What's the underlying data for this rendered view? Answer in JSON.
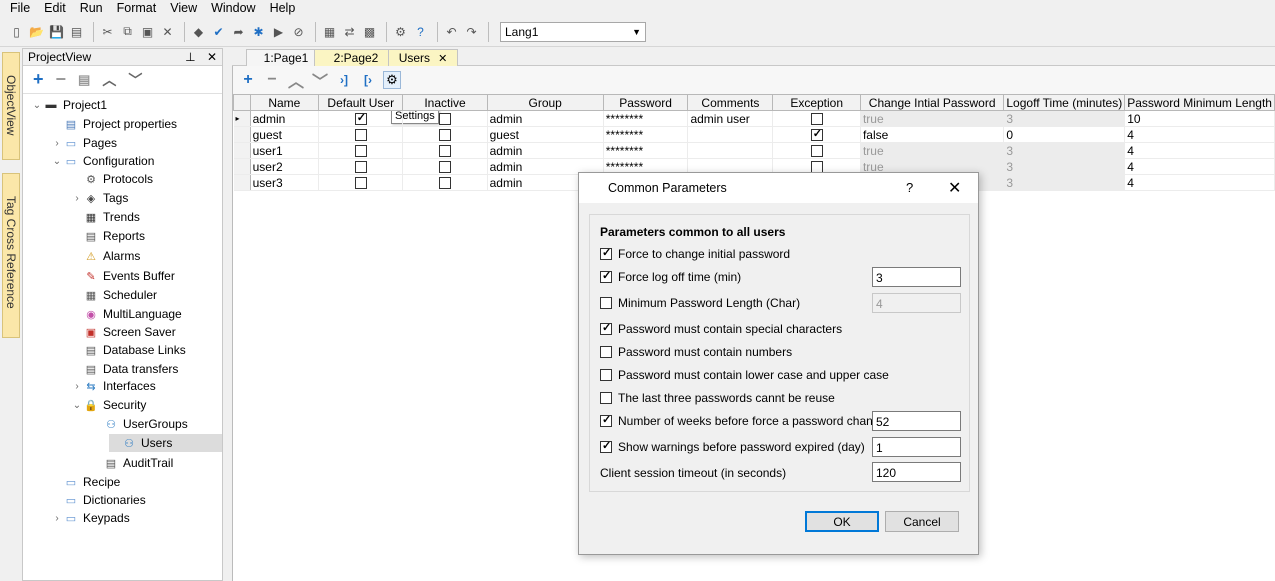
{
  "menu": [
    "File",
    "Edit",
    "Run",
    "Format",
    "View",
    "Window",
    "Help"
  ],
  "toolbar": {
    "language": "Lang1"
  },
  "side_tabs": {
    "objectview": "ObjectView",
    "tagcross": "Tag Cross Reference"
  },
  "projectview": {
    "title": "ProjectView",
    "pin": "⊥",
    "close": "✕",
    "tree": [
      {
        "label": "Project1",
        "depth": 0,
        "arrow": "⌄",
        "icon": "▬"
      },
      {
        "label": "Project properties",
        "depth": 1,
        "arrow": "",
        "icon": "▤"
      },
      {
        "label": "Pages",
        "depth": 1,
        "arrow": "›",
        "icon": "▭"
      },
      {
        "label": "Configuration",
        "depth": 1,
        "arrow": "⌄",
        "icon": "▭"
      },
      {
        "label": "Protocols",
        "depth": 2,
        "arrow": "",
        "icon": "⚙"
      },
      {
        "label": "Tags",
        "depth": 2,
        "arrow": "›",
        "icon": "◈"
      },
      {
        "label": "Trends",
        "depth": 2,
        "arrow": "",
        "icon": "▦"
      },
      {
        "label": "Reports",
        "depth": 2,
        "arrow": "",
        "icon": "▤"
      },
      {
        "label": "Alarms",
        "depth": 2,
        "arrow": "",
        "icon": "⚠"
      },
      {
        "label": "Events Buffer",
        "depth": 2,
        "arrow": "",
        "icon": "✎"
      },
      {
        "label": "Scheduler",
        "depth": 2,
        "arrow": "",
        "icon": "▦"
      },
      {
        "label": "MultiLanguage",
        "depth": 2,
        "arrow": "",
        "icon": "◉"
      },
      {
        "label": "Screen Saver",
        "depth": 2,
        "arrow": "",
        "icon": "▣"
      },
      {
        "label": "Database Links",
        "depth": 2,
        "arrow": "",
        "icon": "▤"
      },
      {
        "label": "Data transfers",
        "depth": 2,
        "arrow": "",
        "icon": "▤"
      },
      {
        "label": "Interfaces",
        "depth": 2,
        "arrow": "›",
        "icon": "⇆"
      },
      {
        "label": "Security",
        "depth": 2,
        "arrow": "⌄",
        "icon": "🔒"
      },
      {
        "label": "UserGroups",
        "depth": 3,
        "arrow": "",
        "icon": "⚇"
      },
      {
        "label": "Users",
        "depth": 3,
        "arrow": "",
        "icon": "⚇"
      },
      {
        "label": "AuditTrail",
        "depth": 3,
        "arrow": "",
        "icon": "▤"
      },
      {
        "label": "Recipe",
        "depth": 1,
        "arrow": "",
        "icon": "▭"
      },
      {
        "label": "Dictionaries",
        "depth": 1,
        "arrow": "",
        "icon": "▭"
      },
      {
        "label": "Keypads",
        "depth": 1,
        "arrow": "›",
        "icon": "▭"
      }
    ]
  },
  "doc_tabs": {
    "page1": "1:Page1",
    "page2": "2:Page2",
    "users": "Users",
    "close": "✕"
  },
  "tooltip": "Settings",
  "grid": {
    "columns": [
      "Name",
      "Default User",
      "Inactive",
      "Group",
      "Password",
      "Comments",
      "Exception",
      "Change Intial Password",
      "Logoff Time (minutes)",
      "Password Minimum Length"
    ],
    "rows": [
      {
        "name": "admin",
        "default": true,
        "inactive": false,
        "group": "admin",
        "password": "********",
        "comments": "admin user",
        "exception": false,
        "change": "true",
        "logoff": "3",
        "minlen": "10"
      },
      {
        "name": "guest",
        "default": false,
        "inactive": false,
        "group": "guest",
        "password": "********",
        "comments": "",
        "exception": true,
        "change": "false",
        "logoff": "0",
        "minlen": "4"
      },
      {
        "name": "user1",
        "default": false,
        "inactive": false,
        "group": "admin",
        "password": "********",
        "comments": "",
        "exception": false,
        "change": "true",
        "logoff": "3",
        "minlen": "4"
      },
      {
        "name": "user2",
        "default": false,
        "inactive": false,
        "group": "admin",
        "password": "********",
        "comments": "",
        "exception": false,
        "change": "true",
        "logoff": "3",
        "minlen": "4"
      },
      {
        "name": "user3",
        "default": false,
        "inactive": false,
        "group": "admin",
        "password": "",
        "comments": "",
        "exception": false,
        "change": "",
        "logoff": "3",
        "minlen": "4"
      }
    ]
  },
  "dialog": {
    "title": "Common Parameters",
    "help": "?",
    "close": "✕",
    "heading": "Parameters common to all users",
    "options": [
      {
        "label": "Force to change initial password",
        "checked": true,
        "value": null
      },
      {
        "label": "Force log off time (min)",
        "checked": true,
        "value": "3"
      },
      {
        "label": "Minimum Password Length (Char)",
        "checked": false,
        "value": "4"
      },
      {
        "label": "Password must contain special characters",
        "checked": true,
        "value": null
      },
      {
        "label": "Password must contain numbers",
        "checked": false,
        "value": null
      },
      {
        "label": "Password must contain lower case and upper case",
        "checked": false,
        "value": null
      },
      {
        "label": "The last three passwords cannt be reuse",
        "checked": false,
        "value": null
      },
      {
        "label": "Number of weeks before force a password change",
        "checked": true,
        "value": "52"
      },
      {
        "label": "Show warnings before password expired (day)",
        "checked": true,
        "value": "1"
      }
    ],
    "session_label": "Client session timeout (in seconds)",
    "session_value": "120",
    "ok": "OK",
    "cancel": "Cancel"
  },
  "colors": {
    "accent": "#0078d7",
    "tab_active": "#fbf5c3",
    "side_tab": "#fbe7a9"
  }
}
